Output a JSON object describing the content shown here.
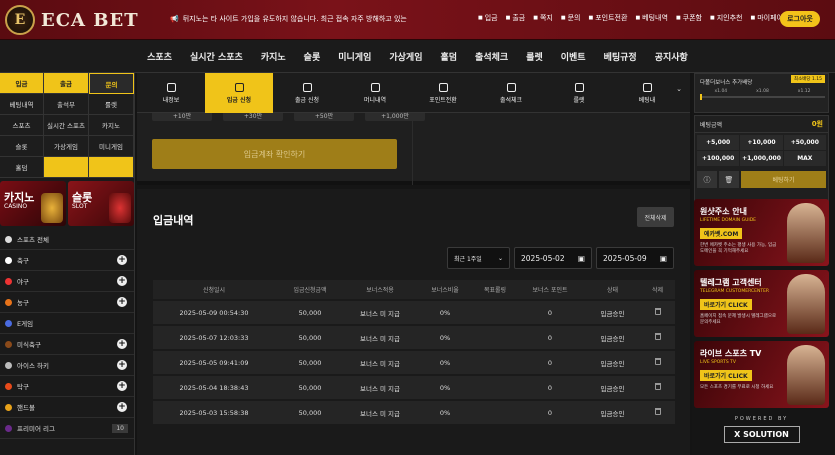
{
  "header": {
    "brand": "ECA BET",
    "logo_letter": "E",
    "notice": "뒤지노는 타 사이트 가입을 유도하지 않습니다. 최근 접속 자주 방해하고 있는",
    "topnav": [
      "입금",
      "출금",
      "쪽지",
      "문의",
      "포인트전환",
      "베팅내역",
      "쿠폰함",
      "지인추천",
      "마이페이지"
    ],
    "logout": "로그아웃"
  },
  "mainnav": [
    "스포츠",
    "실시간 스포츠",
    "카지노",
    "슬롯",
    "미니게임",
    "가상게임",
    "홀덤",
    "출석체크",
    "룰렛",
    "이벤트",
    "베팅규정",
    "공지사항"
  ],
  "sidebar": {
    "quick": [
      {
        "label": "입금",
        "style": "y"
      },
      {
        "label": "출금",
        "style": "y"
      },
      {
        "label": "문의",
        "style": "yl"
      },
      {
        "label": "베팅내역",
        "style": ""
      },
      {
        "label": "출석부",
        "style": ""
      },
      {
        "label": "룰렛",
        "style": ""
      },
      {
        "label": "스포츠",
        "style": ""
      },
      {
        "label": "실시간 스포츠",
        "style": ""
      },
      {
        "label": "카지노",
        "style": ""
      },
      {
        "label": "슬롯",
        "style": ""
      },
      {
        "label": "가상게임",
        "style": ""
      },
      {
        "label": "미니게임",
        "style": ""
      },
      {
        "label": "홀덤",
        "style": ""
      },
      {
        "label": "",
        "style": "y"
      },
      {
        "label": "",
        "style": "y"
      }
    ],
    "banners": [
      {
        "title": "카지노",
        "sub": "CASINO"
      },
      {
        "title": "슬롯",
        "sub": "SLOT"
      }
    ],
    "sports": [
      {
        "label": "스포츠 전체",
        "color": "#ddd",
        "plus": false
      },
      {
        "label": "축구",
        "color": "#fff",
        "plus": true
      },
      {
        "label": "야구",
        "color": "#e33",
        "plus": true
      },
      {
        "label": "농구",
        "color": "#e8731a",
        "plus": true
      },
      {
        "label": "E게임",
        "color": "#4a6be0",
        "plus": false
      },
      {
        "label": "미식축구",
        "color": "#8a4a1a",
        "plus": true
      },
      {
        "label": "아이스 하키",
        "color": "#bbb",
        "plus": true
      },
      {
        "label": "탁구",
        "color": "#e84a1a",
        "plus": true
      },
      {
        "label": "핸드볼",
        "color": "#e8a21a",
        "plus": true
      },
      {
        "label": "프리미어 리그",
        "color": "#6a2a8a",
        "plus": false,
        "count": "10"
      }
    ]
  },
  "tabs": [
    "내정보",
    "입금 신청",
    "출금 신청",
    "머니내역",
    "포인트전환",
    "출석체크",
    "룰렛",
    "베팅내"
  ],
  "deposit": {
    "amounts": [
      "+10만",
      "+30만",
      "+50만",
      "+1,000만"
    ],
    "confirm": "입금계좌 확인하기"
  },
  "history": {
    "title": "입금내역",
    "delete_all": "전체삭제",
    "period": "최근 1주일",
    "date_from": "2025-05-02",
    "date_to": "2025-05-09",
    "columns": [
      "신청일시",
      "입금신청금액",
      "보너스적용",
      "보너스비율",
      "목표롤링",
      "보너스 포인트",
      "상태",
      "삭제"
    ],
    "rows": [
      [
        "2025-05-09 00:54:30",
        "50,000",
        "보너스 미 지급",
        "0%",
        "",
        "0",
        "입금승인"
      ],
      [
        "2025-05-07 12:03:33",
        "50,000",
        "보너스 미 지급",
        "0%",
        "",
        "0",
        "입금승인"
      ],
      [
        "2025-05-05 09:41:09",
        "50,000",
        "보너스 미 지급",
        "0%",
        "",
        "0",
        "입금승인"
      ],
      [
        "2025-05-04 18:38:43",
        "50,000",
        "보너스 미 지급",
        "0%",
        "",
        "0",
        "입금승인"
      ],
      [
        "2025-05-03 15:58:38",
        "50,000",
        "보너스 미 지급",
        "0%",
        "",
        "0",
        "입금승인"
      ]
    ]
  },
  "betslip": {
    "label": "다폴더보너스 추가배당",
    "badge": "최소배당 1.15",
    "ticks": [
      "x1.04",
      "x1.08",
      "x1.12"
    ],
    "amount_label": "베팅금액",
    "amount": "0원",
    "chips": [
      "+5,000",
      "+10,000",
      "+50,000",
      "+100,000",
      "+1,000,000",
      "MAX"
    ],
    "bet_btn": "베팅하기"
  },
  "promos": [
    {
      "title": "원샷주소 안내",
      "sub": "LIFETIME DOMAIN GUIDE",
      "btn": "에카벳.COM",
      "desc": "한번 에카벳 주소는 평생 사용 가능, 입금 도메인을 꼭 기억해주세요"
    },
    {
      "title": "텔레그램 고객센터",
      "sub": "TELEGRAM CUSTOMERCENTER",
      "btn": "바로가기 CLICK",
      "desc": "홈페이지 접속 문제 발생시 텔레그램으로 문의주세요"
    },
    {
      "title": "라이브 스포츠 TV",
      "sub": "LIVE SPORTS TV",
      "btn": "바로가기 CLICK",
      "desc": "모든 스포츠 경기를 무료로 시청 하세요"
    }
  ],
  "powered": {
    "label": "POWERED BY",
    "brand": "X SOLUTION"
  }
}
